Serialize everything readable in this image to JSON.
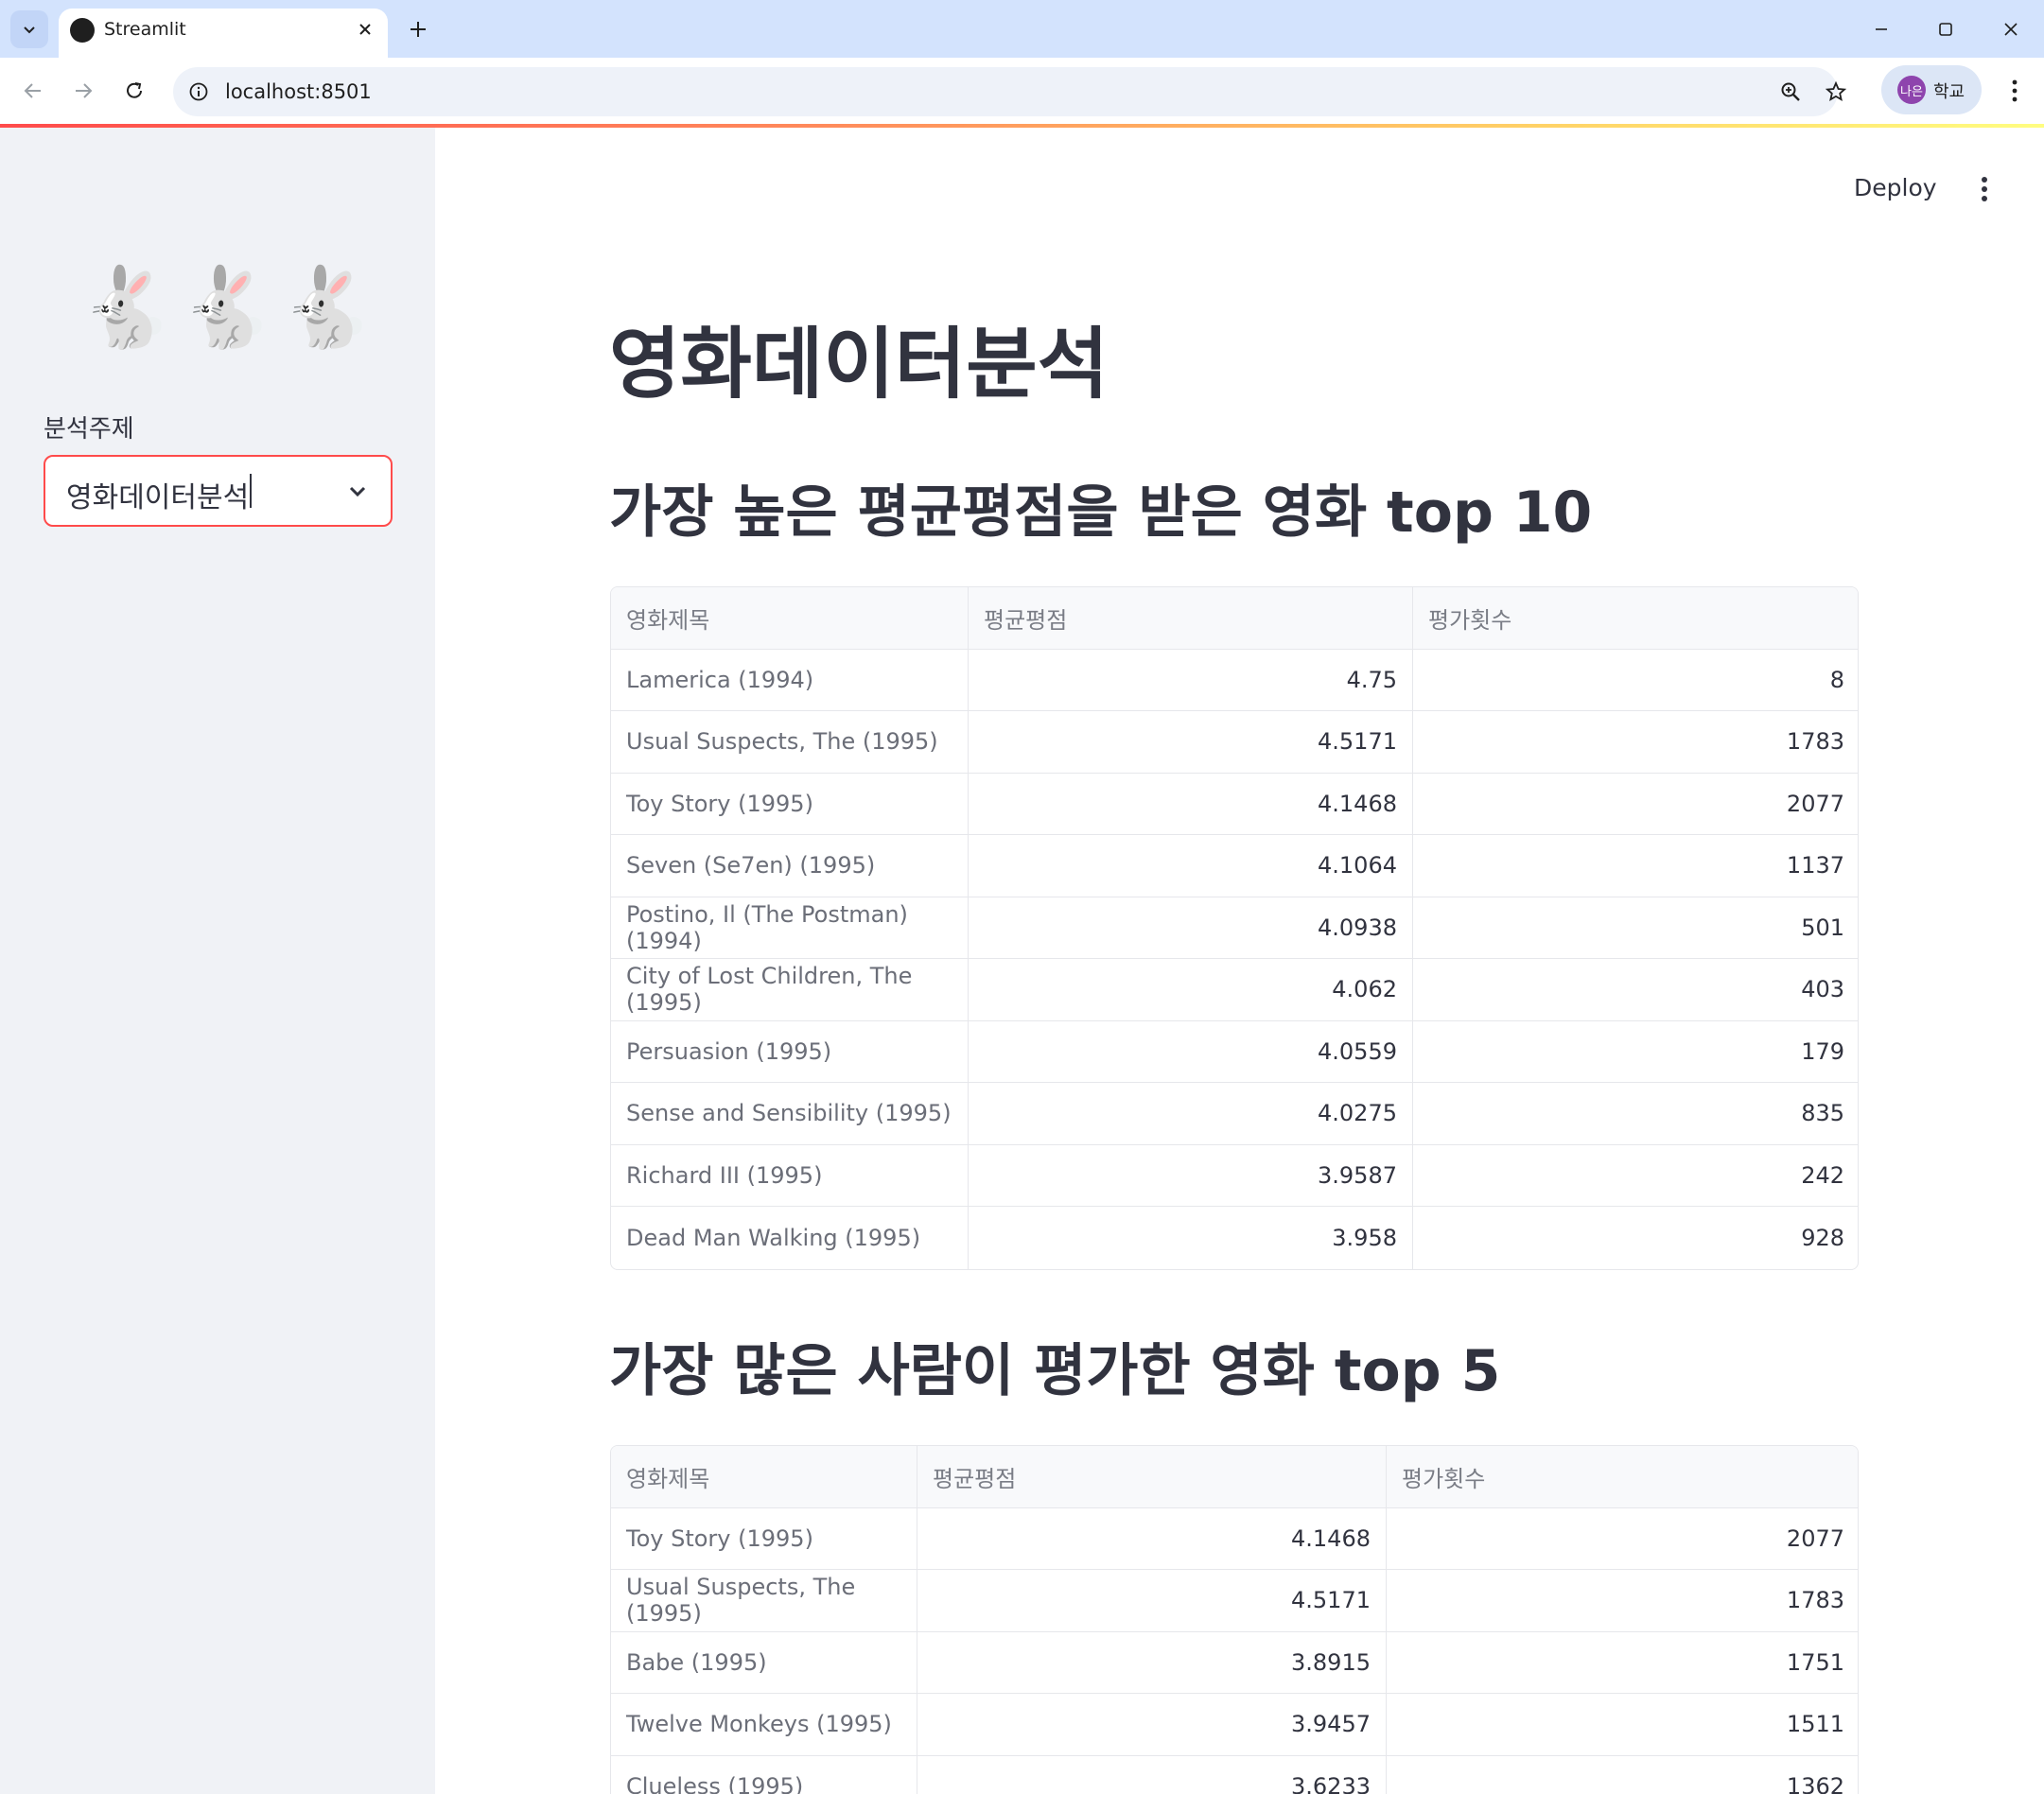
{
  "browser": {
    "tab_title": "Streamlit",
    "url": "localhost:8501",
    "profile_badge": "나은",
    "profile_name": "학교"
  },
  "sidebar": {
    "logo_emoji": "🐇🐇🐇",
    "select_label": "분석주제",
    "select_value": "영화데이터분석"
  },
  "header": {
    "deploy_label": "Deploy"
  },
  "main": {
    "title": "영화데이터분석",
    "section1": {
      "heading": "가장 높은 평균평점을 받은 영화 top 10",
      "columns": [
        "영화제목",
        "평균평점",
        "평가횟수"
      ],
      "rows": [
        [
          "Lamerica (1994)",
          "4.75",
          "8"
        ],
        [
          "Usual Suspects, The (1995)",
          "4.5171",
          "1783"
        ],
        [
          "Toy Story (1995)",
          "4.1468",
          "2077"
        ],
        [
          "Seven (Se7en) (1995)",
          "4.1064",
          "1137"
        ],
        [
          "Postino, Il (The Postman) (1994)",
          "4.0938",
          "501"
        ],
        [
          "City of Lost Children, The (1995)",
          "4.062",
          "403"
        ],
        [
          "Persuasion (1995)",
          "4.0559",
          "179"
        ],
        [
          "Sense and Sensibility (1995)",
          "4.0275",
          "835"
        ],
        [
          "Richard III (1995)",
          "3.9587",
          "242"
        ],
        [
          "Dead Man Walking (1995)",
          "3.958",
          "928"
        ]
      ]
    },
    "section2": {
      "heading": "가장 많은 사람이 평가한 영화 top 5",
      "columns": [
        "영화제목",
        "평균평점",
        "평가횟수"
      ],
      "rows": [
        [
          "Toy Story (1995)",
          "4.1468",
          "2077"
        ],
        [
          "Usual Suspects, The (1995)",
          "4.5171",
          "1783"
        ],
        [
          "Babe (1995)",
          "3.8915",
          "1751"
        ],
        [
          "Twelve Monkeys (1995)",
          "3.9457",
          "1511"
        ],
        [
          "Clueless (1995)",
          "3.6233",
          "1362"
        ]
      ]
    }
  }
}
